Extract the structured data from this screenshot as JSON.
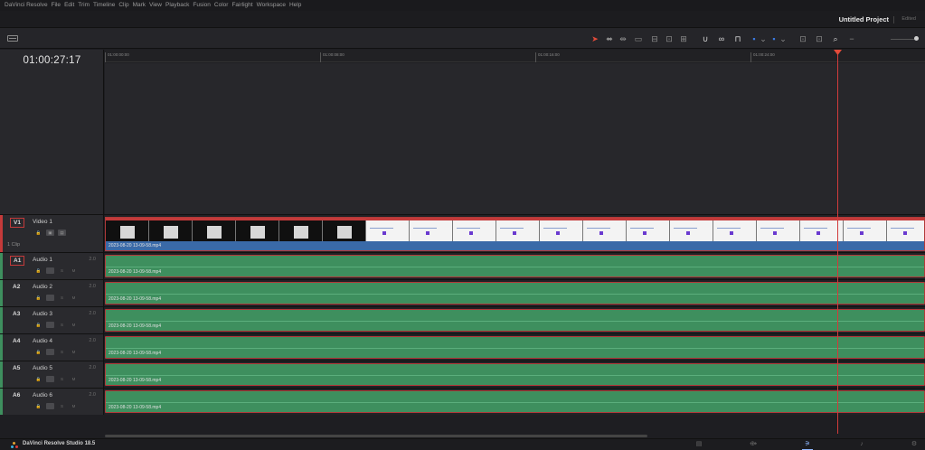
{
  "menu": [
    "DaVinci Resolve",
    "File",
    "Edit",
    "Trim",
    "Timeline",
    "Clip",
    "Mark",
    "View",
    "Playback",
    "Fusion",
    "Color",
    "Fairlight",
    "Workspace",
    "Help"
  ],
  "project": {
    "title": "Untitled Project",
    "status": "Edited"
  },
  "toolbar": {
    "icons": [
      {
        "name": "selection-arrow-icon",
        "glyph": "➤",
        "color": "red"
      },
      {
        "name": "trim-edit-icon",
        "glyph": "⬌"
      },
      {
        "name": "dynamic-trim-icon",
        "glyph": "⇹"
      },
      {
        "name": "blade-icon",
        "glyph": "▭"
      },
      {
        "name": "insert-clip-icon",
        "glyph": "⊟"
      },
      {
        "name": "overwrite-clip-icon",
        "glyph": "⊡"
      },
      {
        "name": "replace-clip-icon",
        "glyph": "⊞"
      },
      {
        "name": "snapping-icon",
        "glyph": "∪",
        "color": "white"
      },
      {
        "name": "linked-selection-icon",
        "glyph": "∞",
        "color": "white"
      },
      {
        "name": "position-lock-icon",
        "glyph": "⊓",
        "color": "white"
      },
      {
        "name": "flag-icon",
        "glyph": "▪",
        "color": "blue"
      },
      {
        "name": "flag-dropdown-icon",
        "glyph": "⌄"
      },
      {
        "name": "marker-icon",
        "glyph": "▪",
        "color": "blue"
      },
      {
        "name": "marker-dropdown-icon",
        "glyph": "⌄"
      },
      {
        "name": "zoom-full-icon",
        "glyph": "⊡"
      },
      {
        "name": "zoom-detail-icon",
        "glyph": "⊡"
      },
      {
        "name": "zoom-custom-icon",
        "glyph": "⌕",
        "color": "white"
      },
      {
        "name": "zoom-out-icon",
        "glyph": "−"
      }
    ]
  },
  "timecode": "01:00:27:17",
  "ruler": [
    "01:00:00:00",
    "01:00:08:00",
    "01:00:16:00",
    "01:00:24:00"
  ],
  "video_track": {
    "id": "V1",
    "name": "Video 1",
    "clip_count": "1 Clip",
    "clip_name": "2023-08-20 13-09-58.mp4",
    "buttons": [
      {
        "name": "lock-icon",
        "glyph": "🔒",
        "ghost": true
      },
      {
        "name": "auto-select-icon",
        "glyph": "▣"
      },
      {
        "name": "track-visibility-icon",
        "glyph": "▤"
      }
    ]
  },
  "audio_tracks": [
    {
      "id": "A1",
      "name": "Audio 1",
      "channels": "2.0",
      "clip_name": "2023-08-20 13-09-58.mp4"
    },
    {
      "id": "A2",
      "name": "Audio 2",
      "channels": "2.0",
      "clip_name": "2023-08-20 13-09-58.mp4"
    },
    {
      "id": "A3",
      "name": "Audio 3",
      "channels": "2.0",
      "clip_name": "2023-08-20 13-09-58.mp4"
    },
    {
      "id": "A4",
      "name": "Audio 4",
      "channels": "2.0",
      "clip_name": "2023-08-20 13-09-58.mp4"
    },
    {
      "id": "A5",
      "name": "Audio 5",
      "channels": "2.0",
      "clip_name": "2023-08-20 13-09-58.mp4"
    },
    {
      "id": "A6",
      "name": "Audio 6",
      "channels": "2.0",
      "clip_name": "2023-08-20 13-09-58.mp4"
    }
  ],
  "audio_buttons": {
    "solo": "S",
    "mute": "M"
  },
  "colors": {
    "video_bar": "#c43a3a",
    "audio_bar": "#3e8f5e",
    "playhead": "#d13b3b",
    "accent_blue": "#3a7be3"
  },
  "status": {
    "product": "DaVinci Resolve Studio 18.5",
    "pages": [
      {
        "name": "page-edit-icon",
        "glyph": "▤"
      },
      {
        "name": "page-fusion-icon",
        "glyph": "⟴"
      },
      {
        "name": "page-color-icon",
        "glyph": "⚞",
        "active": true
      },
      {
        "name": "page-fairlight-icon",
        "glyph": "♪"
      },
      {
        "name": "page-deliver-icon",
        "glyph": "⚙"
      }
    ]
  }
}
